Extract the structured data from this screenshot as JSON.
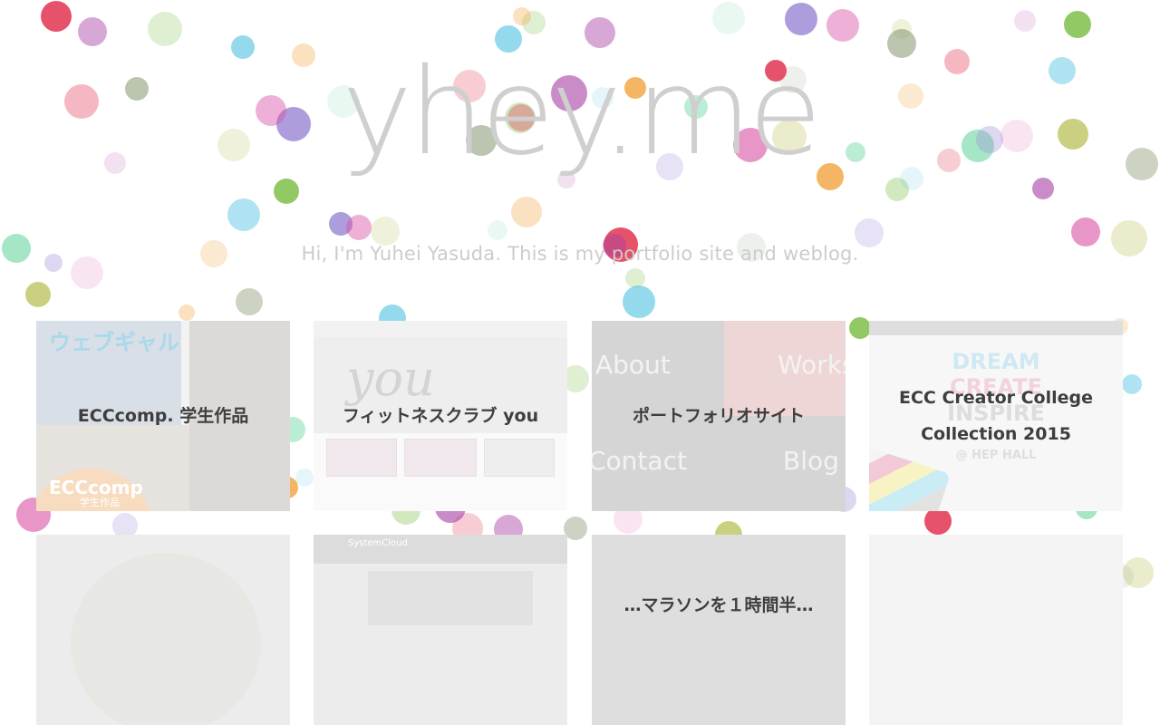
{
  "header": {
    "site_title": "yhey.me",
    "tagline": "Hi, I'm Yuhei Yasuda. This is my portfolio site and weblog."
  },
  "works": [
    {
      "title": "ECCcomp. 学生作品",
      "thumb": {
        "heading": "ウェブギャル",
        "badge": "ECCcomp",
        "badge_sub": "学生作品"
      }
    },
    {
      "title": "フィットネスクラブ you",
      "thumb": {
        "logo": "you"
      }
    },
    {
      "title": "ポートフォリオサイト",
      "thumb": {
        "words": [
          "About",
          "Works",
          "Contact",
          "Blog"
        ]
      }
    },
    {
      "title": "ECC Creator College Collection 2015",
      "thumb": {
        "lines": [
          "DREAM",
          "CREATE",
          "INSPIRE"
        ],
        "venue": "@ HEP HALL"
      }
    }
  ],
  "works_row2": [
    {
      "title": ""
    },
    {
      "title": "",
      "thumb": {
        "logo": "SystemCloud"
      }
    },
    {
      "title": "…マラソンを１時間半…"
    },
    {
      "title": ""
    }
  ],
  "palette": {
    "dots": [
      "#e2344f",
      "#a63fa3",
      "#7fbf4a",
      "#4fc1e0",
      "#f2a94a",
      "#69d6a2",
      "#9f8cd6",
      "#d94fa3",
      "#c2c86a",
      "#8e9e7a"
    ]
  }
}
